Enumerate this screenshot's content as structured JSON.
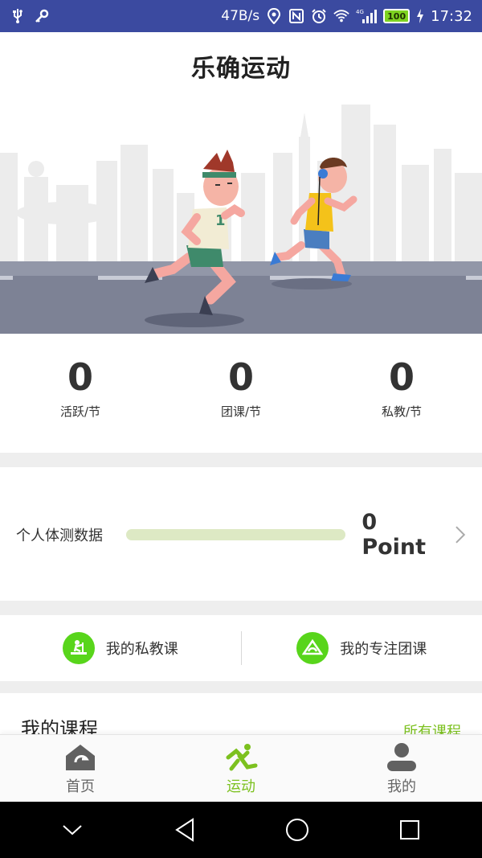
{
  "status_bar": {
    "net_speed": "47B/s",
    "network_type": "4G",
    "battery": "100",
    "time": "17:32",
    "icons": [
      "usb-icon",
      "key-icon",
      "location-icon",
      "nfc-icon",
      "alarm-icon",
      "wifi-icon",
      "signal-icon",
      "charging-icon"
    ]
  },
  "header": {
    "title": "乐确运动"
  },
  "stats": [
    {
      "value": "0",
      "label": "活跃/节"
    },
    {
      "value": "0",
      "label": "团课/节"
    },
    {
      "value": "0",
      "label": "私教/节"
    }
  ],
  "body_test": {
    "label": "个人体测数据",
    "value": "0 Point",
    "progress_fraction": 0.0
  },
  "shortcuts": {
    "private": {
      "label": "我的私教课",
      "icon": "personal-training-icon"
    },
    "group": {
      "label": "我的专注团课",
      "icon": "group-class-icon"
    }
  },
  "my_courses": {
    "title": "我的课程",
    "all_link": "所有课程"
  },
  "tabs": [
    {
      "label": "首页",
      "icon": "home-icon",
      "active": false
    },
    {
      "label": "运动",
      "icon": "running-icon",
      "active": true
    },
    {
      "label": "我的",
      "icon": "user-icon",
      "active": false
    }
  ],
  "colors": {
    "status_bar": "#3b4aa0",
    "accent_green": "#7cc11f",
    "shortcut_green": "#58d51b",
    "progress_track": "#dde9c4"
  }
}
